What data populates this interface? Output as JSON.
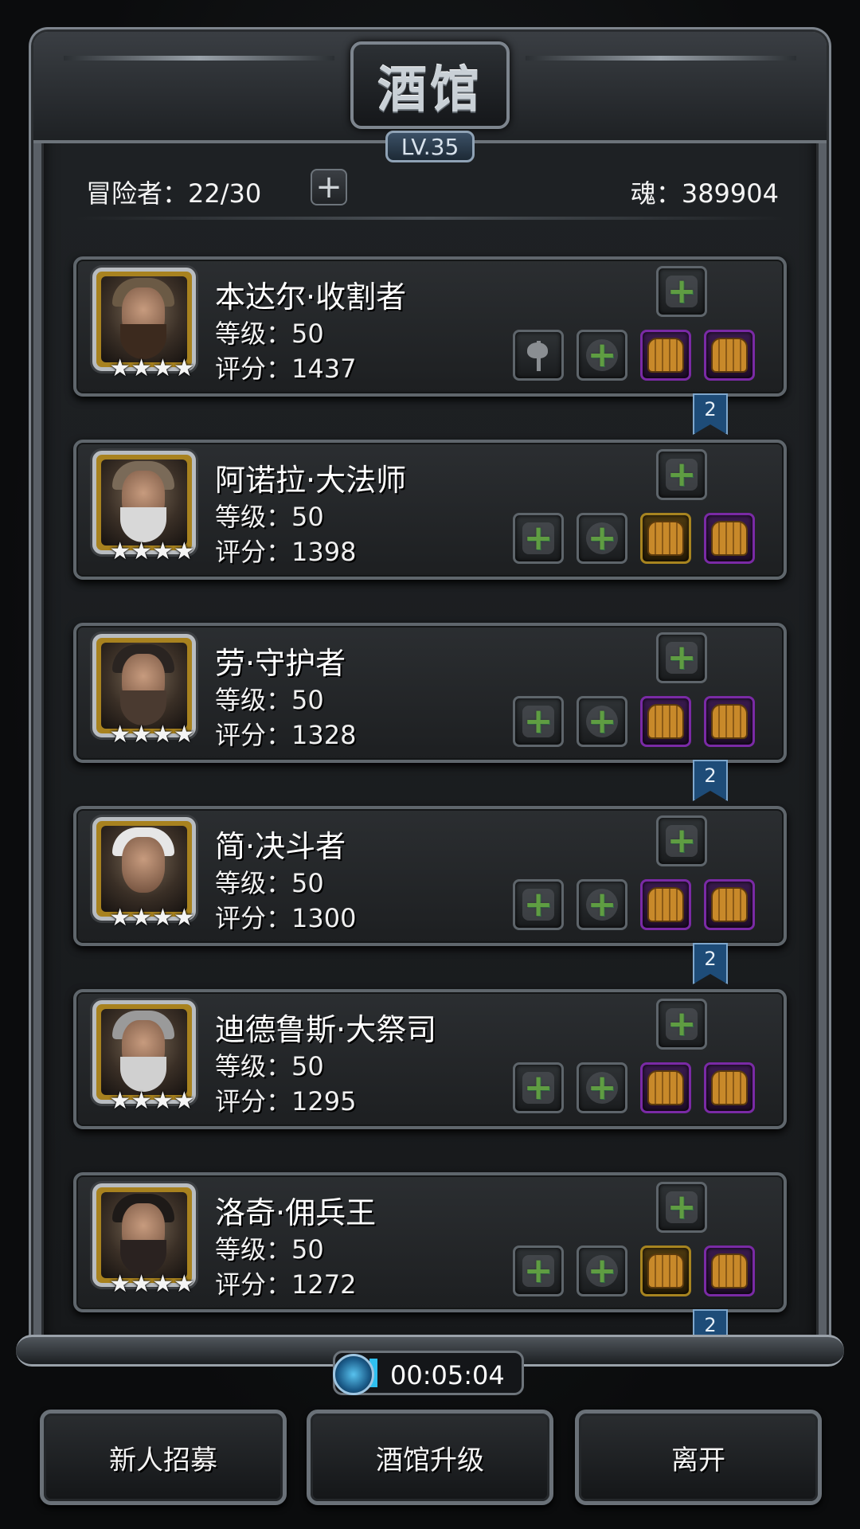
{
  "title": "酒馆",
  "tavern_level": "LV.35",
  "header": {
    "adventurers": "冒险者：22/30",
    "add_symbol": "+",
    "soul": "魂：389904"
  },
  "heroes": [
    {
      "name": "本达尔·收割者",
      "level": "等级：50",
      "score": "评分：1437",
      "stars": "★★★★",
      "ribbon": "2"
    },
    {
      "name": "阿诺拉·大法师",
      "level": "等级：50",
      "score": "评分：1398",
      "stars": "★★★★",
      "ribbon": ""
    },
    {
      "name": "劳·守护者",
      "level": "等级：50",
      "score": "评分：1328",
      "stars": "★★★★",
      "ribbon": "2"
    },
    {
      "name": "简·决斗者",
      "level": "等级：50",
      "score": "评分：1300",
      "stars": "★★★★",
      "ribbon": "2"
    },
    {
      "name": "迪德鲁斯·大祭司",
      "level": "等级：50",
      "score": "评分：1295",
      "stars": "★★★★",
      "ribbon": ""
    },
    {
      "name": "洛奇·佣兵王",
      "level": "等级：50",
      "score": "评分：1272",
      "stars": "★★★★",
      "ribbon": "2"
    }
  ],
  "timer": "00:05:04",
  "buttons": {
    "recruit": "新人招募",
    "upgrade": "酒馆升级",
    "leave": "离开"
  },
  "colors": {
    "plus_green": "#6cf01f",
    "purple_slot": "#7a2aa5",
    "gold_slot": "#a78420",
    "ribbon_blue": "#1e4c78"
  }
}
